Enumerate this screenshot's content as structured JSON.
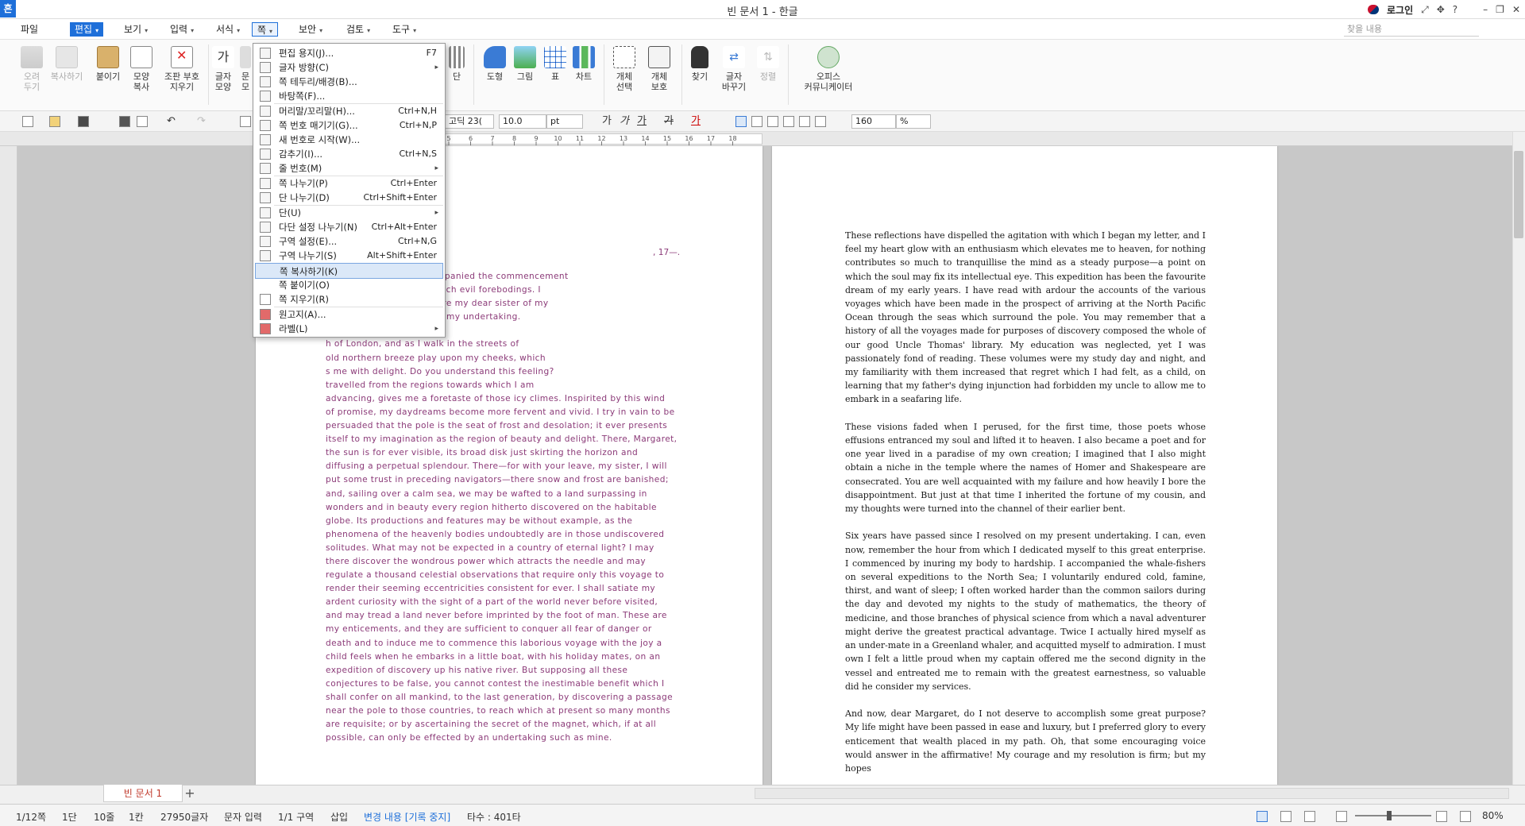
{
  "app": {
    "logo": "흔",
    "title": "빈 문서 1 - 한글",
    "login": "로그인",
    "title_icons": [
      "flag-icon",
      "fullscreen-icon",
      "move-icon",
      "help-icon",
      "minimize-icon",
      "restore-icon",
      "close-icon"
    ]
  },
  "menubar": {
    "items": [
      {
        "label": "파일"
      },
      {
        "label": "편집",
        "arrow": "▾"
      },
      {
        "label": "보기",
        "arrow": "▾"
      },
      {
        "label": "입력",
        "arrow": "▾"
      },
      {
        "label": "서식",
        "arrow": "▾"
      },
      {
        "label": "쪽",
        "arrow": "▾"
      },
      {
        "label": "보안",
        "arrow": "▾"
      },
      {
        "label": "검토",
        "arrow": "▾"
      },
      {
        "label": "도구",
        "arrow": "▾"
      }
    ],
    "search_placeholder": "찾을 내용"
  },
  "ribbon": {
    "cut": "오려\n두기",
    "copy": "복사하기",
    "paste": "붙이기",
    "format_copy": "모양\n복사",
    "clear_format": "조판 부호\n지우기",
    "char_shape": "글자\n모양",
    "para_shape": "문\n모",
    "column": "단",
    "shape": "도형",
    "picture": "그림",
    "table": "표",
    "chart": "차트",
    "select_object": "개체\n선택",
    "protect_object": "개체\n보호",
    "find": "찾기",
    "replace": "글자\n바꾸기",
    "sort": "정렬",
    "office_communicator": "오피스\n커뮤니케이터"
  },
  "format_bar": {
    "font": "고딕 23(",
    "font_size": "10.0",
    "size_unit": "pt",
    "zoom": "160",
    "zoom_unit": "%",
    "bold": "가",
    "italic": "가",
    "underline": "가",
    "strike": "가",
    "font_color": "가"
  },
  "ruler": {
    "ticks": [
      "5",
      "6",
      "7",
      "8",
      "9",
      "10",
      "11",
      "12",
      "13",
      "14",
      "15",
      "16",
      "17",
      "18"
    ]
  },
  "dropdown": {
    "items": [
      {
        "label": "편집 용지(J)...",
        "shortcut": "F7"
      },
      {
        "label": "글자 방향(C)",
        "arrow": "▸"
      },
      {
        "label": "쪽 테두리/배경(B)..."
      },
      {
        "label": "바탕쪽(F)..."
      },
      {
        "label": "머리말/꼬리말(H)...",
        "shortcut": "Ctrl+N,H"
      },
      {
        "label": "쪽 번호 매기기(G)...",
        "shortcut": "Ctrl+N,P"
      },
      {
        "label": "새 번호로 시작(W)..."
      },
      {
        "label": "감추기(I)...",
        "shortcut": "Ctrl+N,S"
      },
      {
        "label": "줄 번호(M)",
        "arrow": "▸"
      },
      {
        "label": "쪽 나누기(P)",
        "shortcut": "Ctrl+Enter"
      },
      {
        "label": "단 나누기(D)",
        "shortcut": "Ctrl+Shift+Enter"
      },
      {
        "label": "단(U)",
        "arrow": "▸"
      },
      {
        "label": "다단 설정 나누기(N)",
        "shortcut": "Ctrl+Alt+Enter"
      },
      {
        "label": "구역 설정(E)...",
        "shortcut": "Ctrl+N,G"
      },
      {
        "label": "구역 나누기(S)",
        "shortcut": "Alt+Shift+Enter"
      },
      {
        "label": "쪽 복사하기(K)"
      },
      {
        "label": "쪽 붙이기(O)"
      },
      {
        "label": "쪽 지우기(R)"
      },
      {
        "label": "원고지(A)..."
      },
      {
        "label": "라벨(L)",
        "arrow": "▸"
      }
    ]
  },
  "page1": {
    "date_line": ", 17—.",
    "visible_text": "hat no disaster has accompanied the commencement\nyou have regarded with such evil forebodings. I\nnd my first task is to assure my dear sister of my\nnfidence in the success of my undertaking.\n\nh of London, and as I walk in the streets of\nold northern breeze play upon my cheeks, which\ns me with delight. Do you understand this feeling?\n travelled from the regions towards which I am\nadvancing, gives me a foretaste of those icy climes. Inspirited by this wind\nof promise, my daydreams become more fervent and vivid. I try in vain to be\npersuaded that the pole is the seat of frost and desolation; it ever presents\nitself to my imagination as the region of beauty and delight. There, Margaret,\nthe sun is for ever visible, its broad disk just skirting the horizon and\ndiffusing a perpetual splendour. There—for with your leave, my sister, I will\nput some trust in preceding navigators—there snow and frost are banished;\nand, sailing over a calm sea, we may be wafted to a land surpassing in\nwonders and in beauty every region hitherto discovered on the habitable\nglobe. Its productions and features may be without example, as the\nphenomena of the heavenly bodies undoubtedly are in those undiscovered\nsolitudes. What may not be expected in a country of eternal light? I may\nthere discover the wondrous power which attracts the needle and may\nregulate a thousand celestial observations that require only this voyage to\nrender their seeming eccentricities consistent for ever. I shall satiate my\nardent curiosity with the sight of a part of the world never before visited,\nand may tread a land never before imprinted by the foot of man. These are\nmy enticements, and they are sufficient to conquer all fear of danger or\ndeath and to induce me to commence this laborious voyage with the joy a\nchild feels when he embarks in a little boat, with his holiday mates, on an\nexpedition of discovery up his native river. But supposing all these\nconjectures to be false, you cannot contest the inestimable benefit which I\nshall confer on all mankind, to the last generation, by discovering a passage\nnear the pole to those countries, to reach which at present so many months\nare requisite; or by ascertaining the secret of the magnet, which, if at all\npossible, can only be effected by an undertaking such as mine."
  },
  "page2": {
    "text": "These reflections have dispelled the agitation with which I began my letter, and I feel my heart glow with an enthusiasm which elevates me to heaven, for nothing contributes so much to tranquillise the mind as a steady purpose—a point on which the soul may fix its intellectual eye. This expedition has been the favourite dream of my early years. I have read with ardour the accounts of the various voyages which have been made in the prospect of arriving at the North Pacific Ocean through the seas which surround the pole. You may remember that a history of all the voyages made for purposes of discovery composed the whole of our good Uncle Thomas' library. My education was neglected, yet I was passionately fond of reading. These volumes were my study day and night, and my familiarity with them increased that regret which I had felt, as a child, on learning that my father's dying injunction had forbidden my uncle to allow me to embark in a seafaring life.\n\nThese visions faded when I perused, for the first time, those poets whose effusions entranced my soul and lifted it to heaven. I also became a poet and for one year lived in a paradise of my own creation; I imagined that I also might obtain a niche in the temple where the names of Homer and Shakespeare are consecrated. You are well acquainted with my failure and how heavily I bore the disappointment. But just at that time I inherited the fortune of my cousin, and my thoughts were turned into the channel of their earlier bent.\n\nSix years have passed since I resolved on my present undertaking. I can, even now, remember the hour from which I dedicated myself to this great enterprise. I commenced by inuring my body to hardship. I accompanied the whale-fishers on several expeditions to the North Sea; I voluntarily endured cold, famine, thirst, and want of sleep; I often worked harder than the common sailors during the day and devoted my nights to the study of mathematics, the theory of medicine, and those branches of physical science from which a naval adventurer might derive the greatest practical advantage. Twice I actually hired myself as an under-mate in a Greenland whaler, and acquitted myself to admiration. I must own I felt a little proud when my captain offered me the second dignity in the vessel and entreated me to remain with the greatest earnestness, so valuable did he consider my services.\n\nAnd now, dear Margaret, do I not deserve to accomplish some great purpose? My life might have been passed in ease and luxury, but I preferred glory to every enticement that wealth placed in my path. Oh, that some encouraging voice would answer in the affirmative! My courage and my resolution is firm; but my hopes"
  },
  "tabs": {
    "doc_tab": "빈 문서 1",
    "add": "+"
  },
  "status": {
    "page": "1/12쪽",
    "column": "1단",
    "line": "10줄",
    "col": "1칸",
    "chars": "27950글자",
    "mode": "문자 입력",
    "section": "1/1 구역",
    "insert": "삽입",
    "track": "변경 내용 [기록 중지]",
    "keystrokes": "타수 : 401타",
    "zoom": "80%"
  }
}
